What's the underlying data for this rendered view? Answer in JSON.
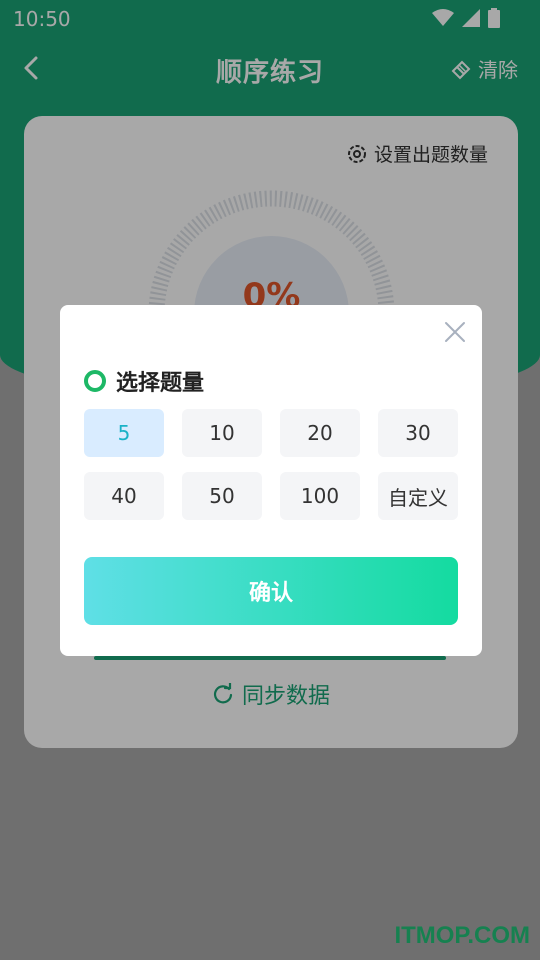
{
  "status_bar": {
    "time": "10:50"
  },
  "nav": {
    "title": "顺序练习",
    "clear_label": "清除"
  },
  "card": {
    "settings_label": "设置出题数量",
    "progress_percent": "0%",
    "sync_label": "同步数据"
  },
  "modal": {
    "heading": "选择题量",
    "options": [
      "5",
      "10",
      "20",
      "30",
      "40",
      "50",
      "100",
      "自定义"
    ],
    "selected_option": "5",
    "confirm_label": "确认"
  },
  "watermark": "ITMOP.COM",
  "colors": {
    "brand_green": "#1aa375",
    "accent_percent": "#e0562a",
    "selected_bg": "#d9ecff",
    "selected_text": "#1ab2c7"
  },
  "icons": [
    "back-arrow-icon",
    "eraser-icon",
    "gear-icon",
    "refresh-icon",
    "close-icon",
    "wifi-icon",
    "signal-icon",
    "battery-icon"
  ]
}
